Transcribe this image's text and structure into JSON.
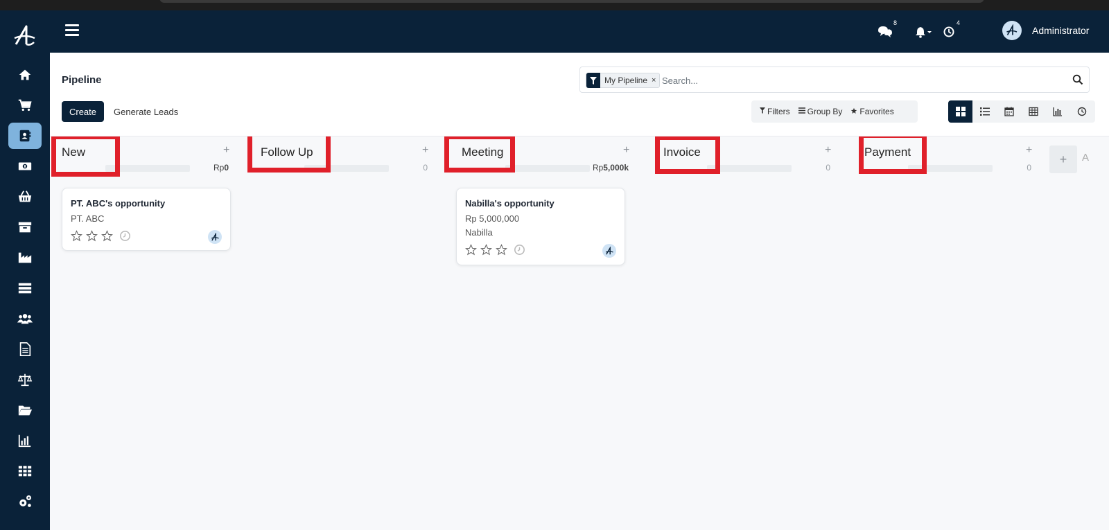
{
  "navbar": {
    "messages_count": "8",
    "activities_count": "4",
    "user_name": "Administrator"
  },
  "page": {
    "title": "Pipeline",
    "create_label": "Create",
    "generate_leads_label": "Generate Leads"
  },
  "search": {
    "facet_label": "My Pipeline",
    "facet_remove": "×",
    "placeholder": "Search..."
  },
  "filters": {
    "filters_label": "Filters",
    "group_by_label": "Group By",
    "favorites_label": "Favorites"
  },
  "columns": [
    {
      "title": "New",
      "total_prefix": "Rp",
      "total_value": "0"
    },
    {
      "title": "Follow Up",
      "total_prefix": "",
      "total_value": "0"
    },
    {
      "title": "Meeting",
      "total_prefix": "Rp",
      "total_value": "5,000k"
    },
    {
      "title": "Invoice",
      "total_prefix": "",
      "total_value": "0"
    },
    {
      "title": "Payment",
      "total_prefix": "",
      "total_value": "0"
    }
  ],
  "cards": [
    {
      "title": "PT. ABC's opportunity",
      "line1": "PT. ABC"
    },
    {
      "title": "Nabilla's opportunity",
      "line1": "Rp 5,000,000",
      "line2": "Nabilla"
    }
  ],
  "add_column_label": "A",
  "colors": {
    "navy": "#0a2239",
    "highlight": "#e0202a",
    "active_sidebar": "#7fb3dd"
  },
  "icons": {
    "sidebar": [
      "home-icon",
      "cart-icon",
      "contacts-icon",
      "money-icon",
      "basket-icon",
      "archive-icon",
      "factory-icon",
      "storage-icon",
      "team-icon",
      "document-icon",
      "scale-icon",
      "folder-icon",
      "chart-icon",
      "apps-icon",
      "gears-icon"
    ]
  }
}
